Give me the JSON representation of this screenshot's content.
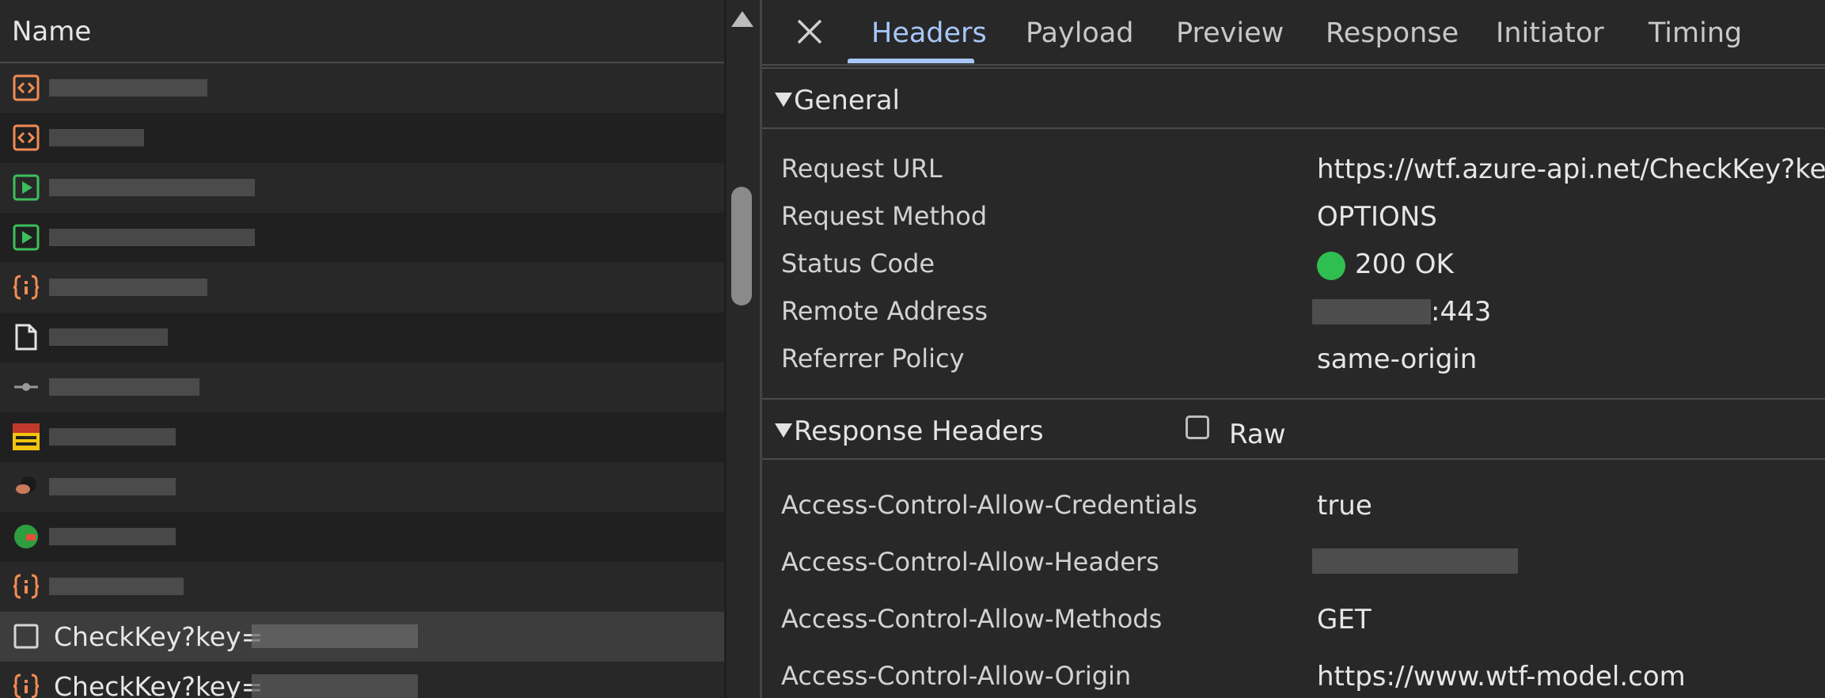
{
  "name_column": {
    "header": "Name"
  },
  "requests": [
    {
      "type": "document-code",
      "label": ""
    },
    {
      "type": "document-code",
      "label": ""
    },
    {
      "type": "media",
      "label": ""
    },
    {
      "type": "media",
      "label": ""
    },
    {
      "type": "json",
      "label": ""
    },
    {
      "type": "file",
      "label": ""
    },
    {
      "type": "ping",
      "label": ""
    },
    {
      "type": "image-ad",
      "label": ""
    },
    {
      "type": "image-avatar",
      "label": ""
    },
    {
      "type": "image-green",
      "label": ""
    },
    {
      "type": "json",
      "label": ""
    },
    {
      "type": "preflight",
      "label": "CheckKey?key="
    },
    {
      "type": "json",
      "label": "CheckKey?key="
    }
  ],
  "tabs": [
    "Headers",
    "Payload",
    "Preview",
    "Response",
    "Initiator",
    "Timing"
  ],
  "active_tab": "Headers",
  "general": {
    "title": "General",
    "request_url_key": "Request URL",
    "request_url": "https://wtf.azure-api.net/CheckKey?key=",
    "request_method_key": "Request Method",
    "request_method": "OPTIONS",
    "status_code_key": "Status Code",
    "status_code": "200 OK",
    "remote_address_key": "Remote Address",
    "remote_address_suffix": ":443",
    "referrer_policy_key": "Referrer Policy",
    "referrer_policy": "same-origin"
  },
  "response_headers": {
    "title": "Response Headers",
    "raw_label": "Raw",
    "allow_credentials_key": "Access-Control-Allow-Credentials",
    "allow_credentials": "true",
    "allow_headers_key": "Access-Control-Allow-Headers",
    "allow_methods_key": "Access-Control-Allow-Methods",
    "allow_methods": "GET",
    "allow_origin_key": "Access-Control-Allow-Origin",
    "allow_origin": "https://www.wtf-model.com"
  },
  "colors": {
    "accent": "#a8c7fa",
    "status_ok": "#2fbf50",
    "icon_orange": "#f28b54",
    "icon_green": "#3cbf5c"
  }
}
